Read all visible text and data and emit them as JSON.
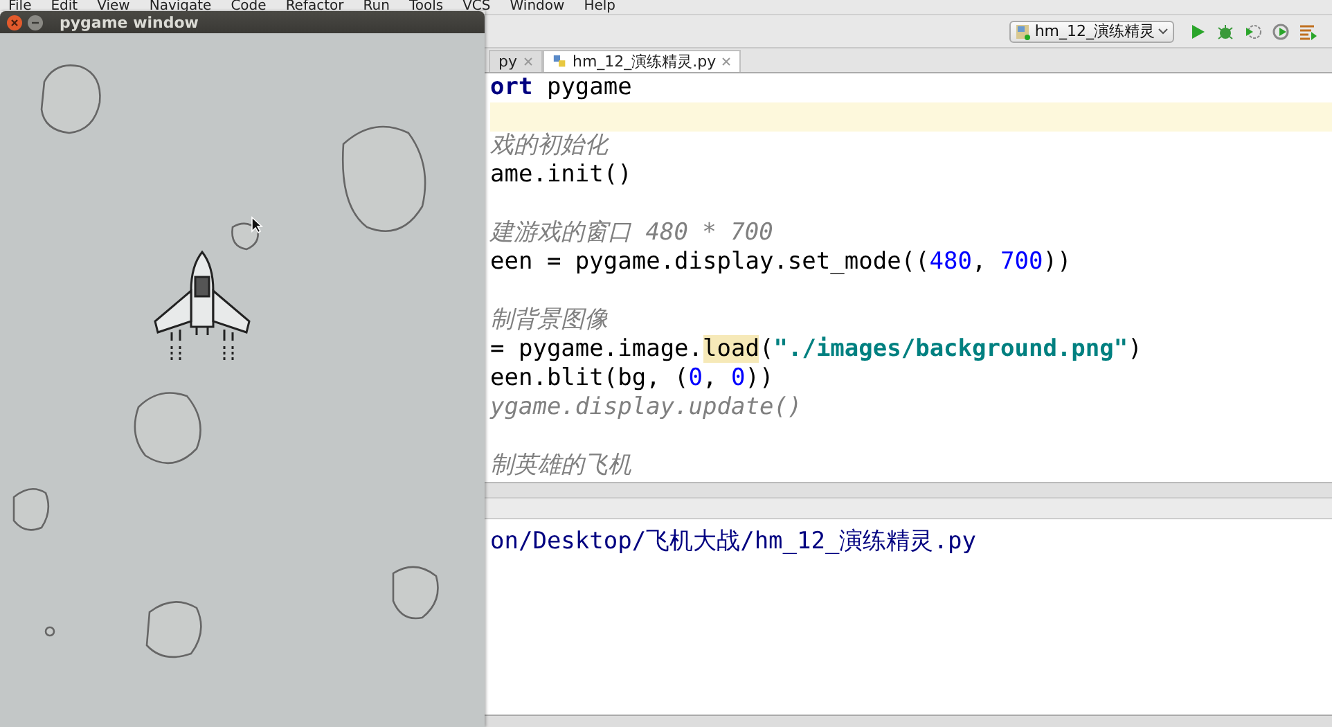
{
  "menu": [
    "File",
    "Edit",
    "View",
    "Navigate",
    "Code",
    "Refactor",
    "Run",
    "Tools",
    "VCS",
    "Window",
    "Help"
  ],
  "toolbar": {
    "run_config": "hm_12_演练精灵"
  },
  "tabs": [
    {
      "label": "py",
      "selected": false
    },
    {
      "label": "hm_12_演练精灵.py",
      "selected": true
    }
  ],
  "editor": {
    "lines": [
      {
        "current": false,
        "tokens": [
          {
            "kind": "keyword",
            "text": "ort"
          },
          {
            "kind": "plain",
            "text": " pygame"
          }
        ]
      },
      {
        "current": true
      },
      {
        "current": false,
        "tokens": [
          {
            "kind": "comment",
            "text": "戏的初始化"
          }
        ]
      },
      {
        "current": false,
        "tokens": [
          {
            "kind": "plain",
            "text": "ame.init()"
          }
        ]
      },
      {
        "current": false
      },
      {
        "current": false,
        "tokens": [
          {
            "kind": "comment",
            "text": "建游戏的窗口 480 * 700"
          }
        ]
      },
      {
        "current": false,
        "tokens": [
          {
            "kind": "plain",
            "text": "een = pygame.display.set_mode(("
          },
          {
            "kind": "number",
            "text": "480"
          },
          {
            "kind": "plain",
            "text": ", "
          },
          {
            "kind": "number",
            "text": "700"
          },
          {
            "kind": "plain",
            "text": "))"
          }
        ]
      },
      {
        "current": false
      },
      {
        "current": false,
        "tokens": [
          {
            "kind": "comment",
            "text": "制背景图像"
          }
        ]
      },
      {
        "current": false,
        "tokens": [
          {
            "kind": "plain",
            "text": "= pygame.image."
          },
          {
            "kind": "match",
            "text": "load"
          },
          {
            "kind": "plain",
            "text": "("
          },
          {
            "kind": "string",
            "text": "\"./images/background.png\""
          },
          {
            "kind": "plain",
            "text": ")"
          }
        ]
      },
      {
        "current": false,
        "tokens": [
          {
            "kind": "plain",
            "text": "een.blit(bg, ("
          },
          {
            "kind": "number",
            "text": "0"
          },
          {
            "kind": "plain",
            "text": ", "
          },
          {
            "kind": "number",
            "text": "0"
          },
          {
            "kind": "plain",
            "text": "))"
          }
        ]
      },
      {
        "current": false,
        "tokens": [
          {
            "kind": "comment",
            "text": "ygame.display.update()"
          }
        ]
      },
      {
        "current": false
      },
      {
        "current": false,
        "tokens": [
          {
            "kind": "comment",
            "text": "制英雄的飞机"
          }
        ]
      }
    ]
  },
  "run_panel": {
    "output": "on/Desktop/飞机大战/hm_12_演练精灵.py"
  },
  "pygame_window": {
    "title": "pygame window"
  }
}
